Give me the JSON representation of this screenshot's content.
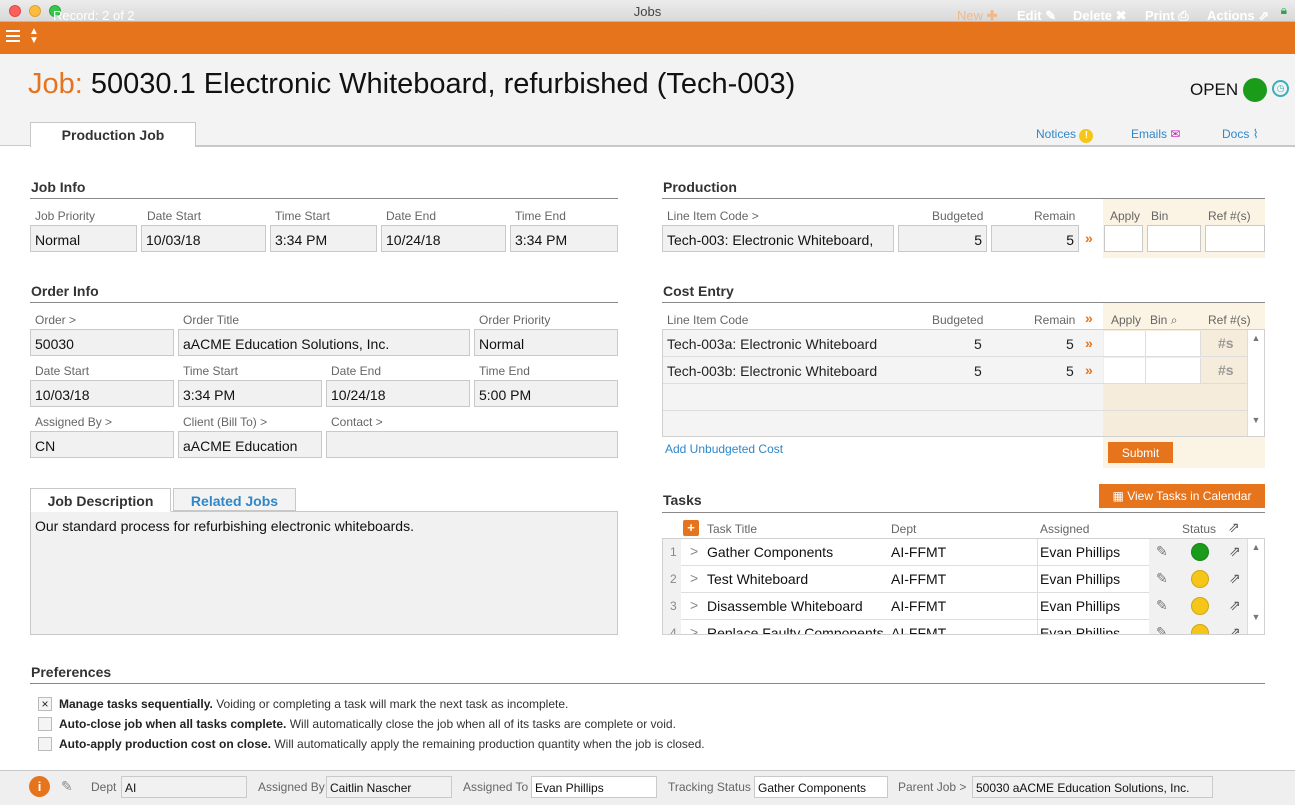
{
  "window": {
    "title": "Jobs"
  },
  "toolbar": {
    "record": "Record: 2 of 2",
    "new": "New",
    "edit": "Edit",
    "delete": "Delete",
    "print": "Print",
    "actions": "Actions"
  },
  "header": {
    "job_label": "Job:",
    "job_title": "50030.1 Electronic Whiteboard, refurbished (Tech-003)",
    "status": "OPEN",
    "tab": "Production Job",
    "notices": "Notices",
    "emails": "Emails",
    "docs": "Docs"
  },
  "job_info": {
    "title": "Job Info",
    "labels": [
      "Job Priority",
      "Date Start",
      "Time Start",
      "Date End",
      "Time End"
    ],
    "values": [
      "Normal",
      "10/03/18",
      "3:34 PM",
      "10/24/18",
      "3:34 PM"
    ]
  },
  "order_info": {
    "title": "Order Info",
    "order_label": "Order >",
    "order": "50030",
    "order_title_label": "Order Title",
    "order_title": "aACME Education Solutions, Inc.",
    "priority_label": "Order Priority",
    "priority": "Normal",
    "date_start_label": "Date Start",
    "date_start": "10/03/18",
    "time_start_label": "Time Start",
    "time_start": "3:34 PM",
    "date_end_label": "Date End",
    "date_end": "10/24/18",
    "time_end_label": "Time End",
    "time_end": "5:00 PM",
    "assigned_by_label": "Assigned By >",
    "assigned_by": "CN",
    "client_label": "Client (Bill To) >",
    "client": "aACME Education",
    "contact_label": "Contact >",
    "contact": ""
  },
  "description": {
    "tab_active": "Job Description",
    "tab_other": "Related Jobs",
    "text": "Our standard process for refurbishing electronic whiteboards."
  },
  "production": {
    "title": "Production",
    "labels": {
      "code": "Line Item Code >",
      "budgeted": "Budgeted",
      "remain": "Remain",
      "apply": "Apply",
      "bin": "Bin",
      "ref": "Ref #(s)"
    },
    "row": {
      "code": "Tech-003: Electronic Whiteboard,",
      "budgeted": "5",
      "remain": "5"
    }
  },
  "cost_entry": {
    "title": "Cost Entry",
    "labels": {
      "code": "Line Item Code",
      "budgeted": "Budgeted",
      "remain": "Remain",
      "apply": "Apply",
      "bin": "Bin",
      "ref": "Ref #(s)"
    },
    "rows": [
      {
        "code": "Tech-003a: Electronic Whiteboard",
        "budgeted": "5",
        "remain": "5"
      },
      {
        "code": "Tech-003b: Electronic Whiteboard",
        "budgeted": "5",
        "remain": "5"
      }
    ],
    "add_link": "Add Unbudgeted Cost",
    "submit": "Submit"
  },
  "tasks": {
    "title": "Tasks",
    "view_button": "View Tasks in Calendar",
    "headers": {
      "title": "Task Title",
      "dept": "Dept",
      "assigned": "Assigned",
      "status": "Status"
    },
    "rows": [
      {
        "num": "1",
        "title": "Gather Components",
        "dept": "AI-FFMT",
        "assigned": "Evan Phillips",
        "status_color": "#1a9b1a"
      },
      {
        "num": "2",
        "title": "Test Whiteboard",
        "dept": "AI-FFMT",
        "assigned": "Evan Phillips",
        "status_color": "#f5c518"
      },
      {
        "num": "3",
        "title": "Disassemble Whiteboard",
        "dept": "AI-FFMT",
        "assigned": "Evan Phillips",
        "status_color": "#f5c518"
      },
      {
        "num": "4",
        "title": "Replace Faulty Components",
        "dept": "AI-FFMT",
        "assigned": "Evan Phillips",
        "status_color": "#f5c518"
      }
    ]
  },
  "preferences": {
    "title": "Preferences",
    "items": [
      {
        "checked": "×",
        "bold": "Manage tasks sequentially.",
        "text": "Voiding or completing a task will mark the next task as incomplete."
      },
      {
        "checked": "",
        "bold": "Auto-close job when all tasks complete.",
        "text": "Will automatically close the job when all of its tasks are complete or void."
      },
      {
        "checked": "",
        "bold": "Auto-apply production cost on close.",
        "text": "Will automatically apply the remaining production quantity when the job is closed."
      }
    ]
  },
  "footer": {
    "dept_label": "Dept",
    "dept": "AI",
    "assigned_by_label": "Assigned By",
    "assigned_by": "Caitlin Nascher",
    "assigned_to_label": "Assigned To",
    "assigned_to": "Evan Phillips",
    "tracking_label": "Tracking Status",
    "tracking": "Gather Components",
    "parent_label": "Parent Job >",
    "parent": "50030 aACME Education Solutions, Inc."
  },
  "colors": {
    "accent": "#e6741c",
    "open_status": "#1a9b1a",
    "link": "#2f87c9"
  }
}
